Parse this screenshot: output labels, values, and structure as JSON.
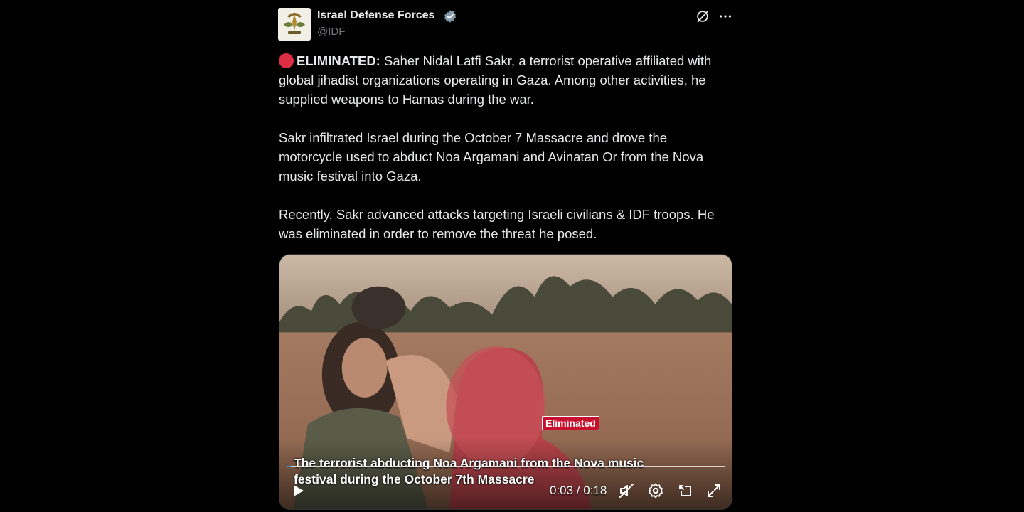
{
  "author": {
    "name": "Israel Defense Forces",
    "handle": "@IDF",
    "verified": true,
    "avatar_icon": "idf-emblem-icon"
  },
  "actions": {
    "grok_icon": "grok-icon",
    "more_icon": "more-options-icon"
  },
  "tweet": {
    "lead_label": "ELIMINATED:",
    "paragraph1_rest": "Saher Nidal Latfi Sakr, a terrorist operative affiliated with global jihadist organizations operating in Gaza. Among other activities, he supplied weapons to Hamas during the war.",
    "paragraph2": "Sakr infiltrated Israel during the October 7 Massacre and drove the motorcycle used to abduct Noa Argamani and Avinatan Or from the Nova music festival into Gaza.",
    "paragraph3": "Recently, Sakr advanced attacks targeting Israeli civilians & IDF troops. He was eliminated in order to remove the threat he posed."
  },
  "video": {
    "overlay_tag": "Eliminated",
    "caption": "The terrorist abducting Noa Argamani from the Nova music festival during the October 7th Massacre",
    "current_time": "0:03",
    "duration": "0:18",
    "time_display": "0:03 / 0:18",
    "progress_fraction": 0.01,
    "controls": [
      "play-icon",
      "mute-icon",
      "settings-icon",
      "dock-icon",
      "fullscreen-icon"
    ]
  },
  "colors": {
    "background": "#000000",
    "text": "#e7e9ea",
    "secondary_text": "#71767b",
    "verified_badge": "#829aab",
    "eliminated_red": "#c8102e",
    "progress": "#1d9bf0"
  }
}
